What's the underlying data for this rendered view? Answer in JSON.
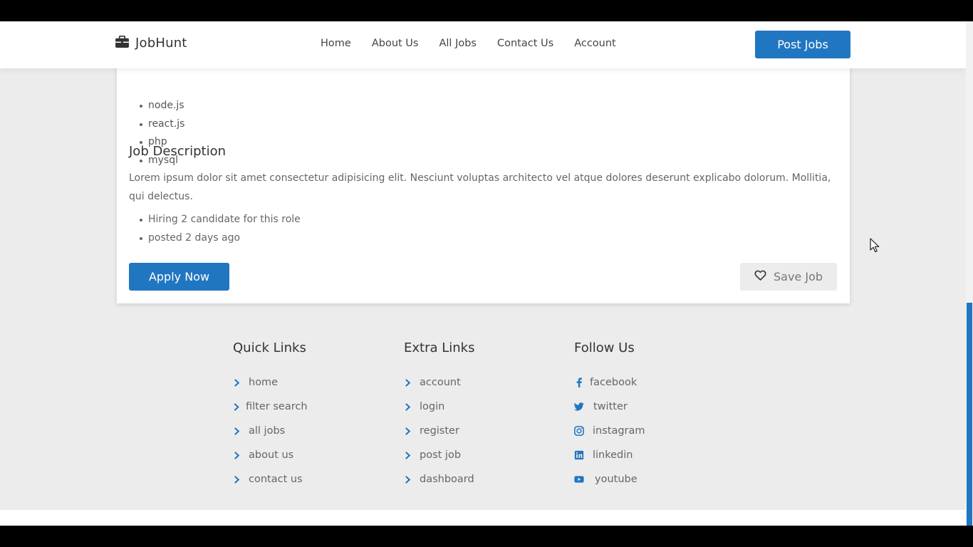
{
  "brand": {
    "name": "JobHunt",
    "icon": "briefcase-icon",
    "accent": "#2176c1"
  },
  "nav": {
    "links": [
      "Home",
      "About Us",
      "All Jobs",
      "Contact Us",
      "Account"
    ],
    "post_label": "Post Jobs"
  },
  "job": {
    "skills": [
      "node.js",
      "react.js",
      "php",
      "mysql"
    ],
    "description_title": "Job Description",
    "description": "Lorem ipsum dolor sit amet consectetur adipisicing elit. Nesciunt voluptas architecto vel atque dolores deserunt explicabo dolorum. Mollitia, qui delectus.",
    "meta": [
      "Hiring 2 candidate for this role",
      "posted 2 days ago"
    ],
    "apply_label": "Apply Now",
    "save_label": "Save Job"
  },
  "footer": {
    "quick_links": {
      "title": "Quick Links",
      "items": [
        "home",
        "filter search",
        "all jobs",
        "about us",
        "contact us"
      ]
    },
    "extra_links": {
      "title": "Extra Links",
      "items": [
        "account",
        "login",
        "register",
        "post job",
        "dashboard"
      ]
    },
    "follow_us": {
      "title": "Follow Us",
      "items": [
        {
          "label": "facebook",
          "icon": "facebook-icon"
        },
        {
          "label": "twitter",
          "icon": "twitter-icon"
        },
        {
          "label": "instagram",
          "icon": "instagram-icon"
        },
        {
          "label": "linkedin",
          "icon": "linkedin-icon"
        },
        {
          "label": "youtube",
          "icon": "youtube-icon"
        }
      ]
    }
  }
}
